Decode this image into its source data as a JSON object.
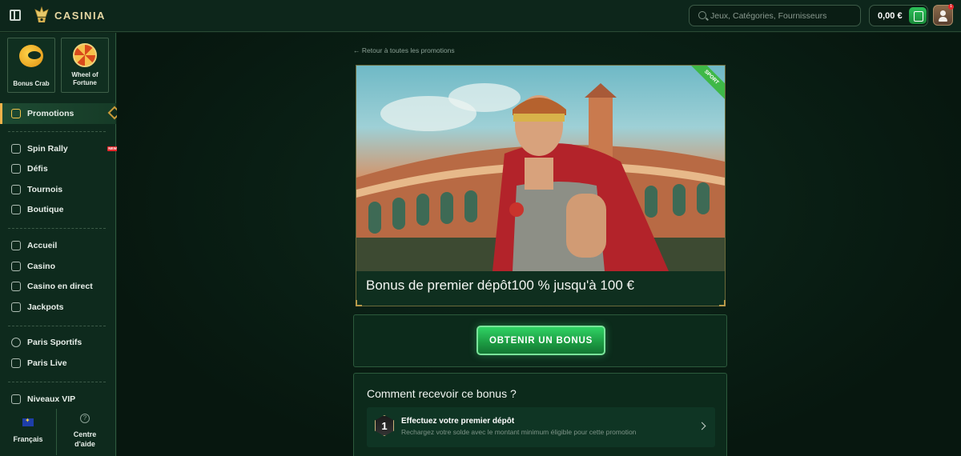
{
  "header": {
    "brand": "CASINIA",
    "search_placeholder": "Jeux, Catégories, Fournisseurs",
    "balance": "0,00 €",
    "notification_count": "1"
  },
  "sidebar": {
    "tiles": [
      {
        "label": "Bonus Crab"
      },
      {
        "label": "Wheel of Fortune"
      }
    ],
    "active_item": "Promotions",
    "groups": [
      [
        {
          "label": "Spin Rally",
          "icon": "flag-icon",
          "badge": "NEW"
        },
        {
          "label": "Défis",
          "icon": "bell-icon"
        },
        {
          "label": "Tournois",
          "icon": "trophy-icon"
        },
        {
          "label": "Boutique",
          "icon": "shop-icon"
        }
      ],
      [
        {
          "label": "Accueil",
          "icon": "home-icon"
        },
        {
          "label": "Casino",
          "icon": "casino-icon"
        },
        {
          "label": "Casino en direct",
          "icon": "live-casino-icon"
        },
        {
          "label": "Jackpots",
          "icon": "jackpot-icon"
        }
      ],
      [
        {
          "label": "Paris Sportifs",
          "icon": "ball-icon"
        },
        {
          "label": "Paris Live",
          "icon": "live-bet-icon"
        }
      ],
      [
        {
          "label": "Niveaux VIP",
          "icon": "crown-icon"
        }
      ]
    ],
    "footer": {
      "language": "Français",
      "help": "Centre d'aide"
    }
  },
  "main": {
    "back_link": "← Retour à toutes les promotions",
    "banner": {
      "ribbon": "SPORT",
      "title": "Bonus de premier dépôt100 % jusqu'à 100 €"
    },
    "cta_label": "OBTENIR UN BONUS",
    "how": {
      "title": "Comment recevoir ce bonus ?",
      "step_number": "1",
      "step_title": "Effectuez votre premier dépôt",
      "step_desc": "Rechargez votre solde avec le montant minimum éligible pour cette promotion"
    }
  },
  "colors": {
    "accent_green": "#2fd264",
    "gold": "#e6d7a3",
    "background": "#0b2016"
  }
}
